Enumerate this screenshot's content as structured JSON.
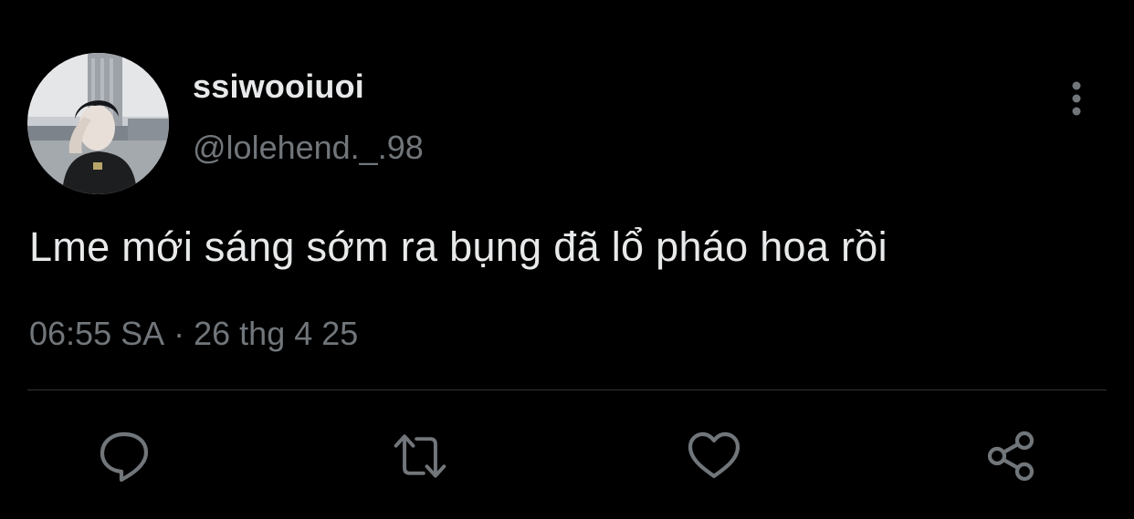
{
  "user": {
    "display_name": "ssiwooiuoi",
    "handle": "@lolehend._.98",
    "avatar_icon": "profile-photo"
  },
  "tweet": {
    "text": "Lme mới sáng sớm ra bụng đã lổ pháo hoa rồi",
    "time": "06:55 SA",
    "separator": "·",
    "date": "26 thg 4 25"
  },
  "actions": {
    "reply_icon": "reply-icon",
    "retweet_icon": "retweet-icon",
    "like_icon": "heart-icon",
    "share_icon": "share-icon",
    "more_icon": "more-vertical-icon"
  },
  "colors": {
    "background": "#000000",
    "primary_text": "#e7e9ea",
    "secondary_text": "#71767b",
    "divider": "#2f3336"
  }
}
